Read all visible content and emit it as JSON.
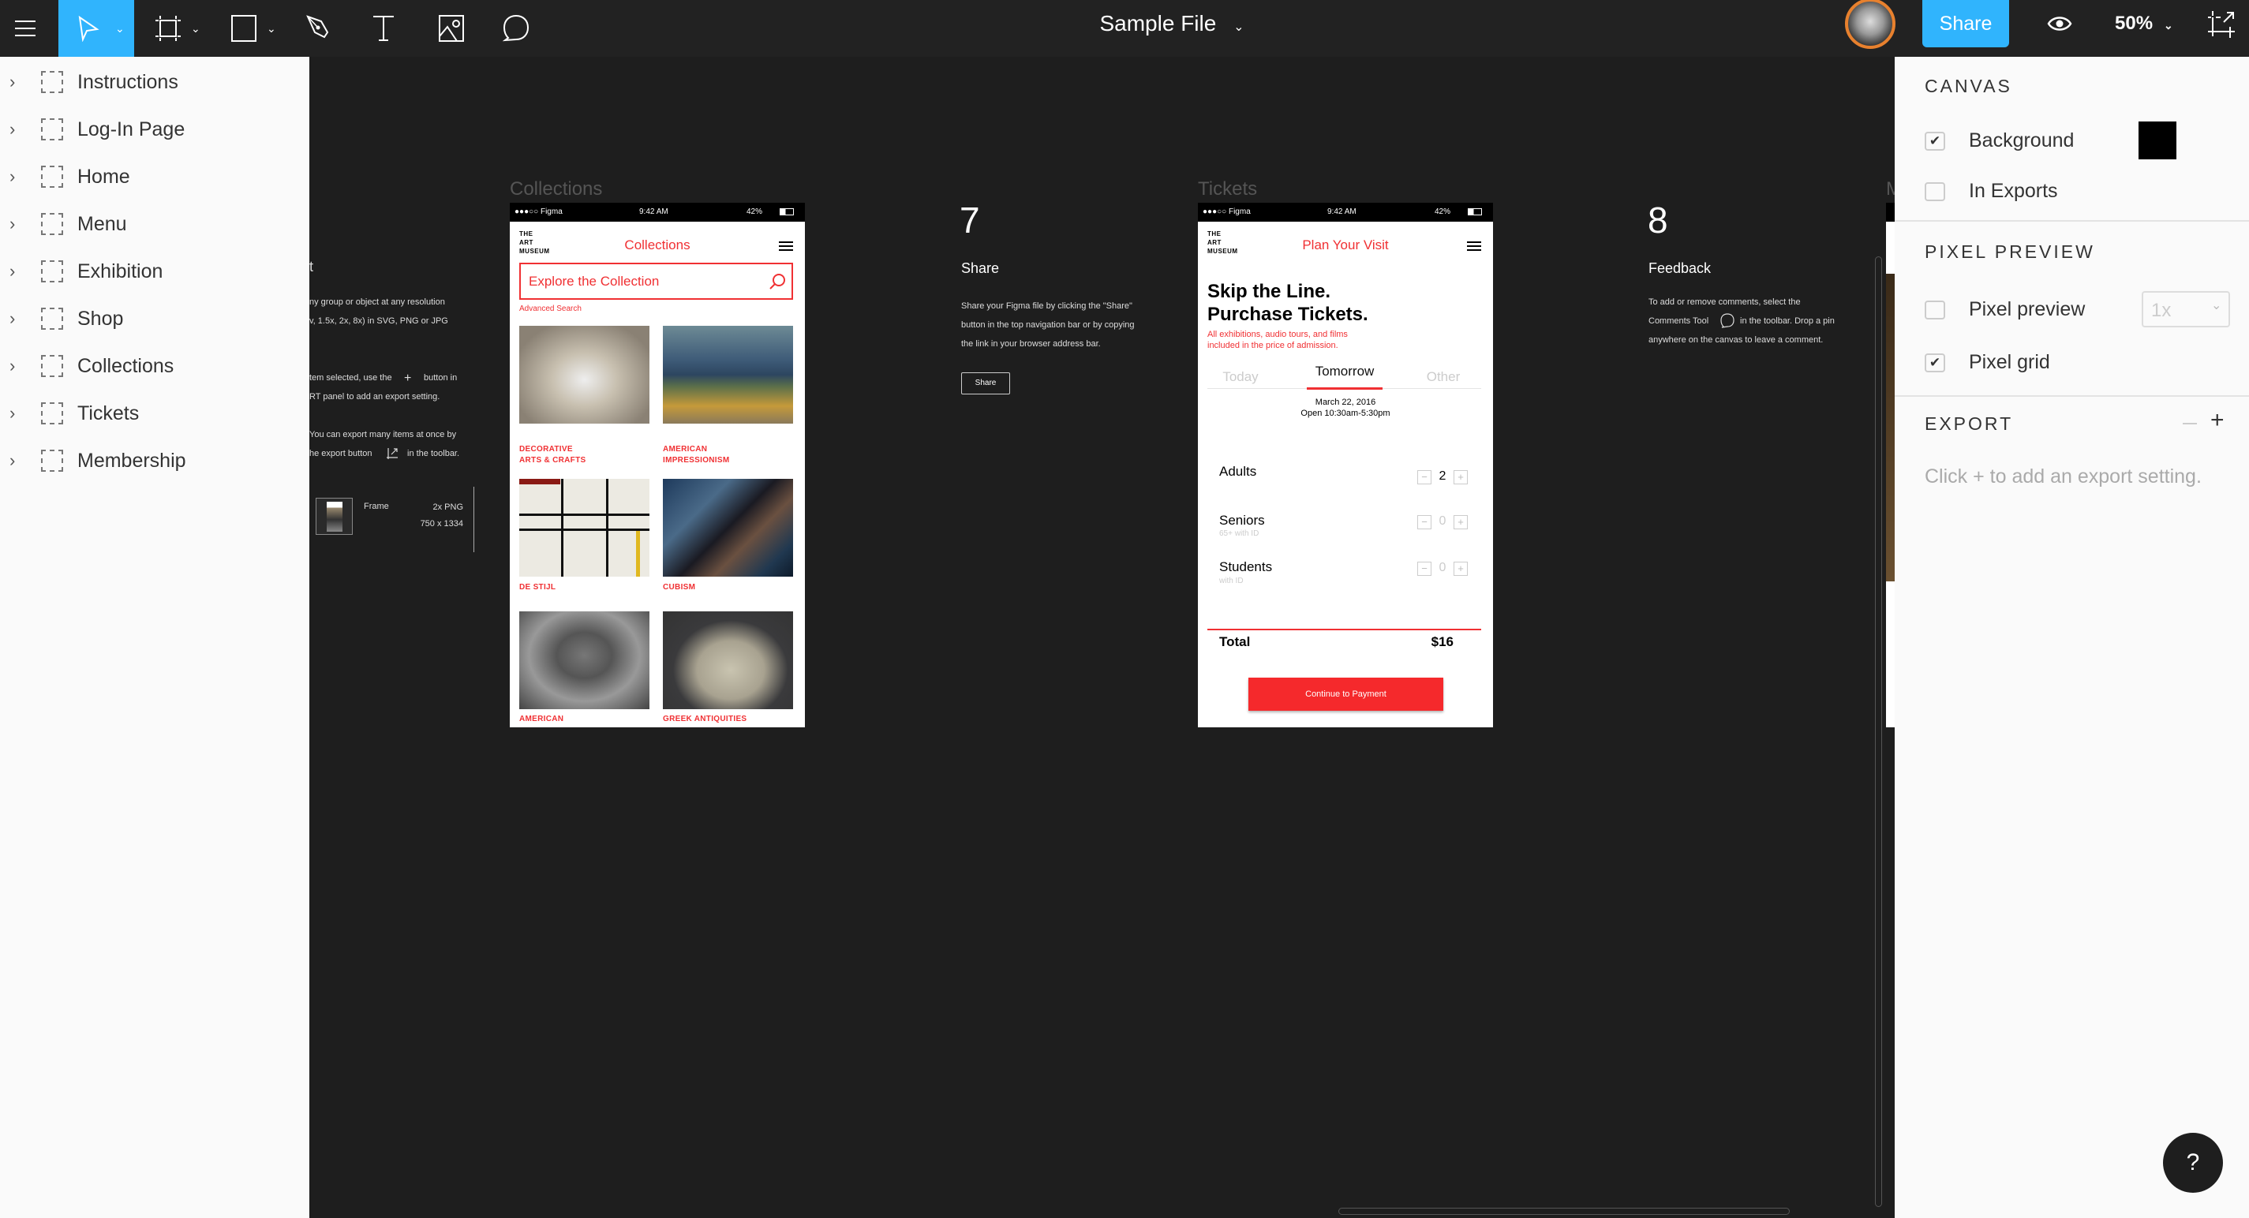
{
  "toolbar": {
    "file_title": "Sample File",
    "share_label": "Share",
    "zoom_level": "50%",
    "accent_color": "#30b4fd",
    "tools": [
      "menu-icon",
      "move-tool-icon",
      "frame-tool-icon",
      "rectangle-tool-icon",
      "pen-tool-icon",
      "text-tool-icon",
      "image-tool-icon",
      "comment-tool-icon"
    ]
  },
  "sidebar": {
    "items": [
      {
        "label": "Instructions"
      },
      {
        "label": "Log-In Page"
      },
      {
        "label": "Home"
      },
      {
        "label": "Menu"
      },
      {
        "label": "Exhibition"
      },
      {
        "label": "Shop"
      },
      {
        "label": "Collections"
      },
      {
        "label": "Tickets"
      },
      {
        "label": "Membership"
      }
    ]
  },
  "canvas": {
    "partial_export": {
      "heading_tail": "t",
      "lines": [
        "ny group or object at any resolution",
        "v, 1.5x, 2x, 8x) in SVG, PNG or JPG",
        "tem selected, use the",
        "button in",
        "RT panel to add an export setting.",
        "You can export many items at once by",
        "he export button",
        "in the toolbar."
      ],
      "frame_name": "Frame",
      "frame_scale": "2x PNG",
      "frame_size": "750 x 1334"
    },
    "collections_frame": {
      "label": "Collections",
      "status": {
        "carrier": "●●●○○ Figma",
        "time": "9:42 AM",
        "battery": "42%"
      },
      "logo": [
        "THE",
        "ART",
        "MUSEUM"
      ],
      "title": "Collections",
      "search_placeholder": "Explore the Collection",
      "advanced_search": "Advanced Search",
      "categories": [
        {
          "label": "DECORATIVE\nARTS & CRAFTS"
        },
        {
          "label": "AMERICAN\nIMPRESSIONISM"
        },
        {
          "label": "DE STIJL"
        },
        {
          "label": "CUBISM"
        },
        {
          "label": "AMERICAN"
        },
        {
          "label": "GREEK ANTIQUITIES"
        }
      ]
    },
    "step7": {
      "number": "7",
      "title": "Share",
      "lines": [
        "Share your Figma file by clicking the \"Share\"",
        "button in the top navigation bar or by copying",
        "the link in your browser address bar."
      ],
      "button": "Share"
    },
    "tickets_frame": {
      "label": "Tickets",
      "status": {
        "carrier": "●●●○○ Figma",
        "time": "9:42 AM",
        "battery": "42%"
      },
      "logo": [
        "THE",
        "ART",
        "MUSEUM"
      ],
      "title": "Plan Your Visit",
      "headline": [
        "Skip the Line.",
        "Purchase Tickets."
      ],
      "subtitle": [
        "All exhibitions, audio tours, and films",
        "included in the price of admission."
      ],
      "tabs": [
        "Today",
        "Tomorrow",
        "Other"
      ],
      "active_tab": "Tomorrow",
      "date": "March 22, 2016",
      "hours": "Open 10:30am-5:30pm",
      "rows": [
        {
          "label": "Adults",
          "sub": "",
          "qty": "2"
        },
        {
          "label": "Seniors",
          "sub": "65+ with ID",
          "qty": "0"
        },
        {
          "label": "Students",
          "sub": "with ID",
          "qty": "0"
        }
      ],
      "total_label": "Total",
      "total_value": "$16",
      "cta": "Continue to Payment",
      "brand_red": "#f03033"
    },
    "step8": {
      "number": "8",
      "title": "Feedback",
      "lines": [
        "To add or remove comments, select the",
        "Comments Tool",
        "in the toolbar. Drop a pin",
        "anywhere on the canvas to leave a comment."
      ]
    },
    "next_frame_label": "M"
  },
  "right_panel": {
    "canvas_section": "CANVAS",
    "background_label": "Background",
    "background_checked": true,
    "background_color": "#000000",
    "in_exports_label": "In Exports",
    "in_exports_checked": false,
    "pixel_preview_section": "PIXEL PREVIEW",
    "pixel_preview_label": "Pixel preview",
    "pixel_preview_checked": false,
    "pixel_preview_scale": "1x",
    "pixel_grid_label": "Pixel grid",
    "pixel_grid_checked": true,
    "export_section": "EXPORT",
    "export_hint": "Click + to add an export setting.",
    "help": "?"
  }
}
